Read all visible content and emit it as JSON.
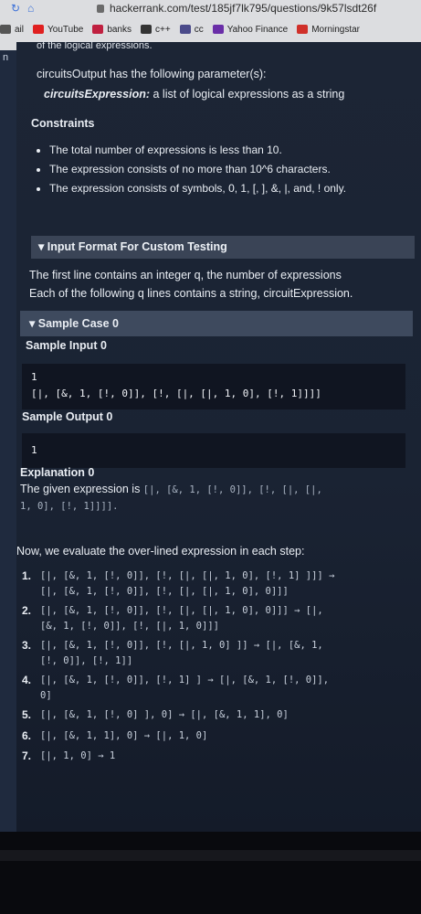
{
  "browser": {
    "url": "hackerrank.com/test/185jf7lk795/questions/9k57lsdt26f",
    "bookmarks": [
      {
        "label": "ail",
        "icon": "mail-icon",
        "color": "#555555"
      },
      {
        "label": "YouTube",
        "icon": "youtube-icon",
        "color": "#e02020"
      },
      {
        "label": "banks",
        "icon": "banks-icon",
        "color": "#c02040"
      },
      {
        "label": "c++",
        "icon": "pluralsight-icon",
        "color": "#333333"
      },
      {
        "label": "cc",
        "icon": "cc-icon",
        "color": "#4a4a8a"
      },
      {
        "label": "Yahoo Finance",
        "icon": "yahoo-icon",
        "color": "#6a2ea8"
      },
      {
        "label": "Morningstar",
        "icon": "morningstar-icon",
        "color": "#d0302a"
      }
    ]
  },
  "gutter_text": "n",
  "content": {
    "clipped_line": "of the logical expressions.",
    "output_intro": "circuitsOutput has the following parameter(s):",
    "param_name": "circuitsExpression:",
    "param_desc": " a list of logical expressions as a string",
    "constraints_title": "Constraints",
    "constraints": [
      "The total number of expressions is less than 10.",
      "The expression consists of no more than 10^6 characters.",
      "The expression consists of symbols, 0, 1, [, ], &, |, and, ! only."
    ],
    "input_format_title": "▾ Input Format For Custom Testing",
    "input_format_line1": "The first line contains an integer q, the number of expressions",
    "input_format_line2": "Each of the following q lines contains a string, circuitExpression.",
    "sample_case_title": "▾ Sample Case 0",
    "sample_input_title": "Sample Input 0",
    "sample_input_lines": [
      "1",
      "[|, [&, 1, [!, 0]], [!, [|, [|, 1, 0], [!, 1]]]]"
    ],
    "sample_output_title": "Sample Output 0",
    "sample_output_value": "1",
    "explanation_title": "Explanation 0",
    "explanation_prefix": "The given expression is ",
    "explanation_code_a": "[|, [&, 1, [!, 0]], [!, [|, [|,",
    "explanation_code_b": "1, 0], [!, 1]]]].",
    "evaluate_line": "Now, we evaluate the over-lined expression in each step:",
    "steps": [
      {
        "num": "1.",
        "lines": [
          "[|, [&, 1, [!, 0]], [!, [|, [|, 1, 0], [!, 1] ]]] →",
          "[|, [&, 1, [!, 0]], [!, [|, [|, 1, 0], 0]]]"
        ]
      },
      {
        "num": "2.",
        "lines": [
          "[|, [&, 1, [!, 0]], [!, [|, [|, 1, 0], 0]]] → [|,",
          "[&, 1, [!, 0]], [!, [|, 1, 0]]]"
        ]
      },
      {
        "num": "3.",
        "lines": [
          "[|, [&, 1, [!, 0]], [!, [|, 1, 0] ]] → [|, [&, 1,",
          "[!, 0]], [!, 1]]"
        ]
      },
      {
        "num": "4.",
        "lines": [
          "[|, [&, 1, [!, 0]], [!, 1] ] → [|, [&, 1, [!, 0]],",
          "0]"
        ]
      },
      {
        "num": "5.",
        "lines": [
          "[|, [&, 1, [!, 0] ], 0] → [|, [&, 1, 1], 0]"
        ]
      },
      {
        "num": "6.",
        "lines": [
          "[|, [&, 1, 1], 0] → [|, 1, 0]"
        ]
      },
      {
        "num": "7.",
        "lines": [
          "[|, 1, 0] → 1"
        ]
      }
    ]
  }
}
